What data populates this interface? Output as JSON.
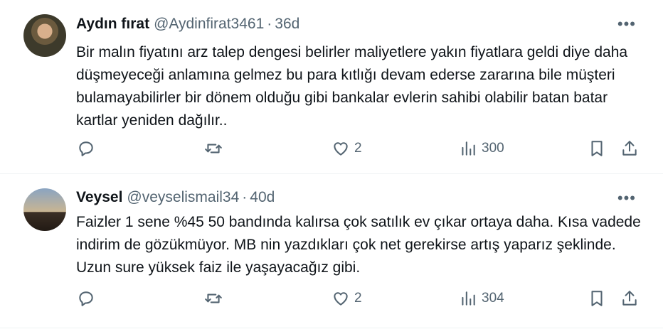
{
  "tweets": [
    {
      "name": "Aydın fırat",
      "handle": "@Aydinfirat3461",
      "separator": "·",
      "time": "36d",
      "text": "Bir malın fiyatını arz talep dengesi belirler maliyetlere yakın fiyatlara geldi diye daha düşmeyeceği anlamına gelmez bu para kıtlığı devam ederse zararına bile müşteri bulamayabilirler bir dönem olduğu gibi bankalar evlerin sahibi olabilir batan batar kartlar yeniden dağılır..",
      "likes": "2",
      "views": "300"
    },
    {
      "name": "Veysel",
      "handle": "@veyselismail34",
      "separator": "·",
      "time": "40d",
      "text": "Faizler 1 sene %45 50 bandında kalırsa çok satılık ev çıkar ortaya daha. Kısa vadede indirim de gözükmüyor. MB nin yazdıkları çok net gerekirse artış yaparız şeklinde. Uzun sure yüksek faiz ile yaşayacağız gibi.",
      "likes": "2",
      "views": "304"
    }
  ],
  "icons": {
    "reply": "reply-icon",
    "retweet": "retweet-icon",
    "like": "heart-icon",
    "views": "views-icon",
    "bookmark": "bookmark-icon",
    "share": "share-icon",
    "more": "more-icon"
  },
  "more_label": "•••"
}
